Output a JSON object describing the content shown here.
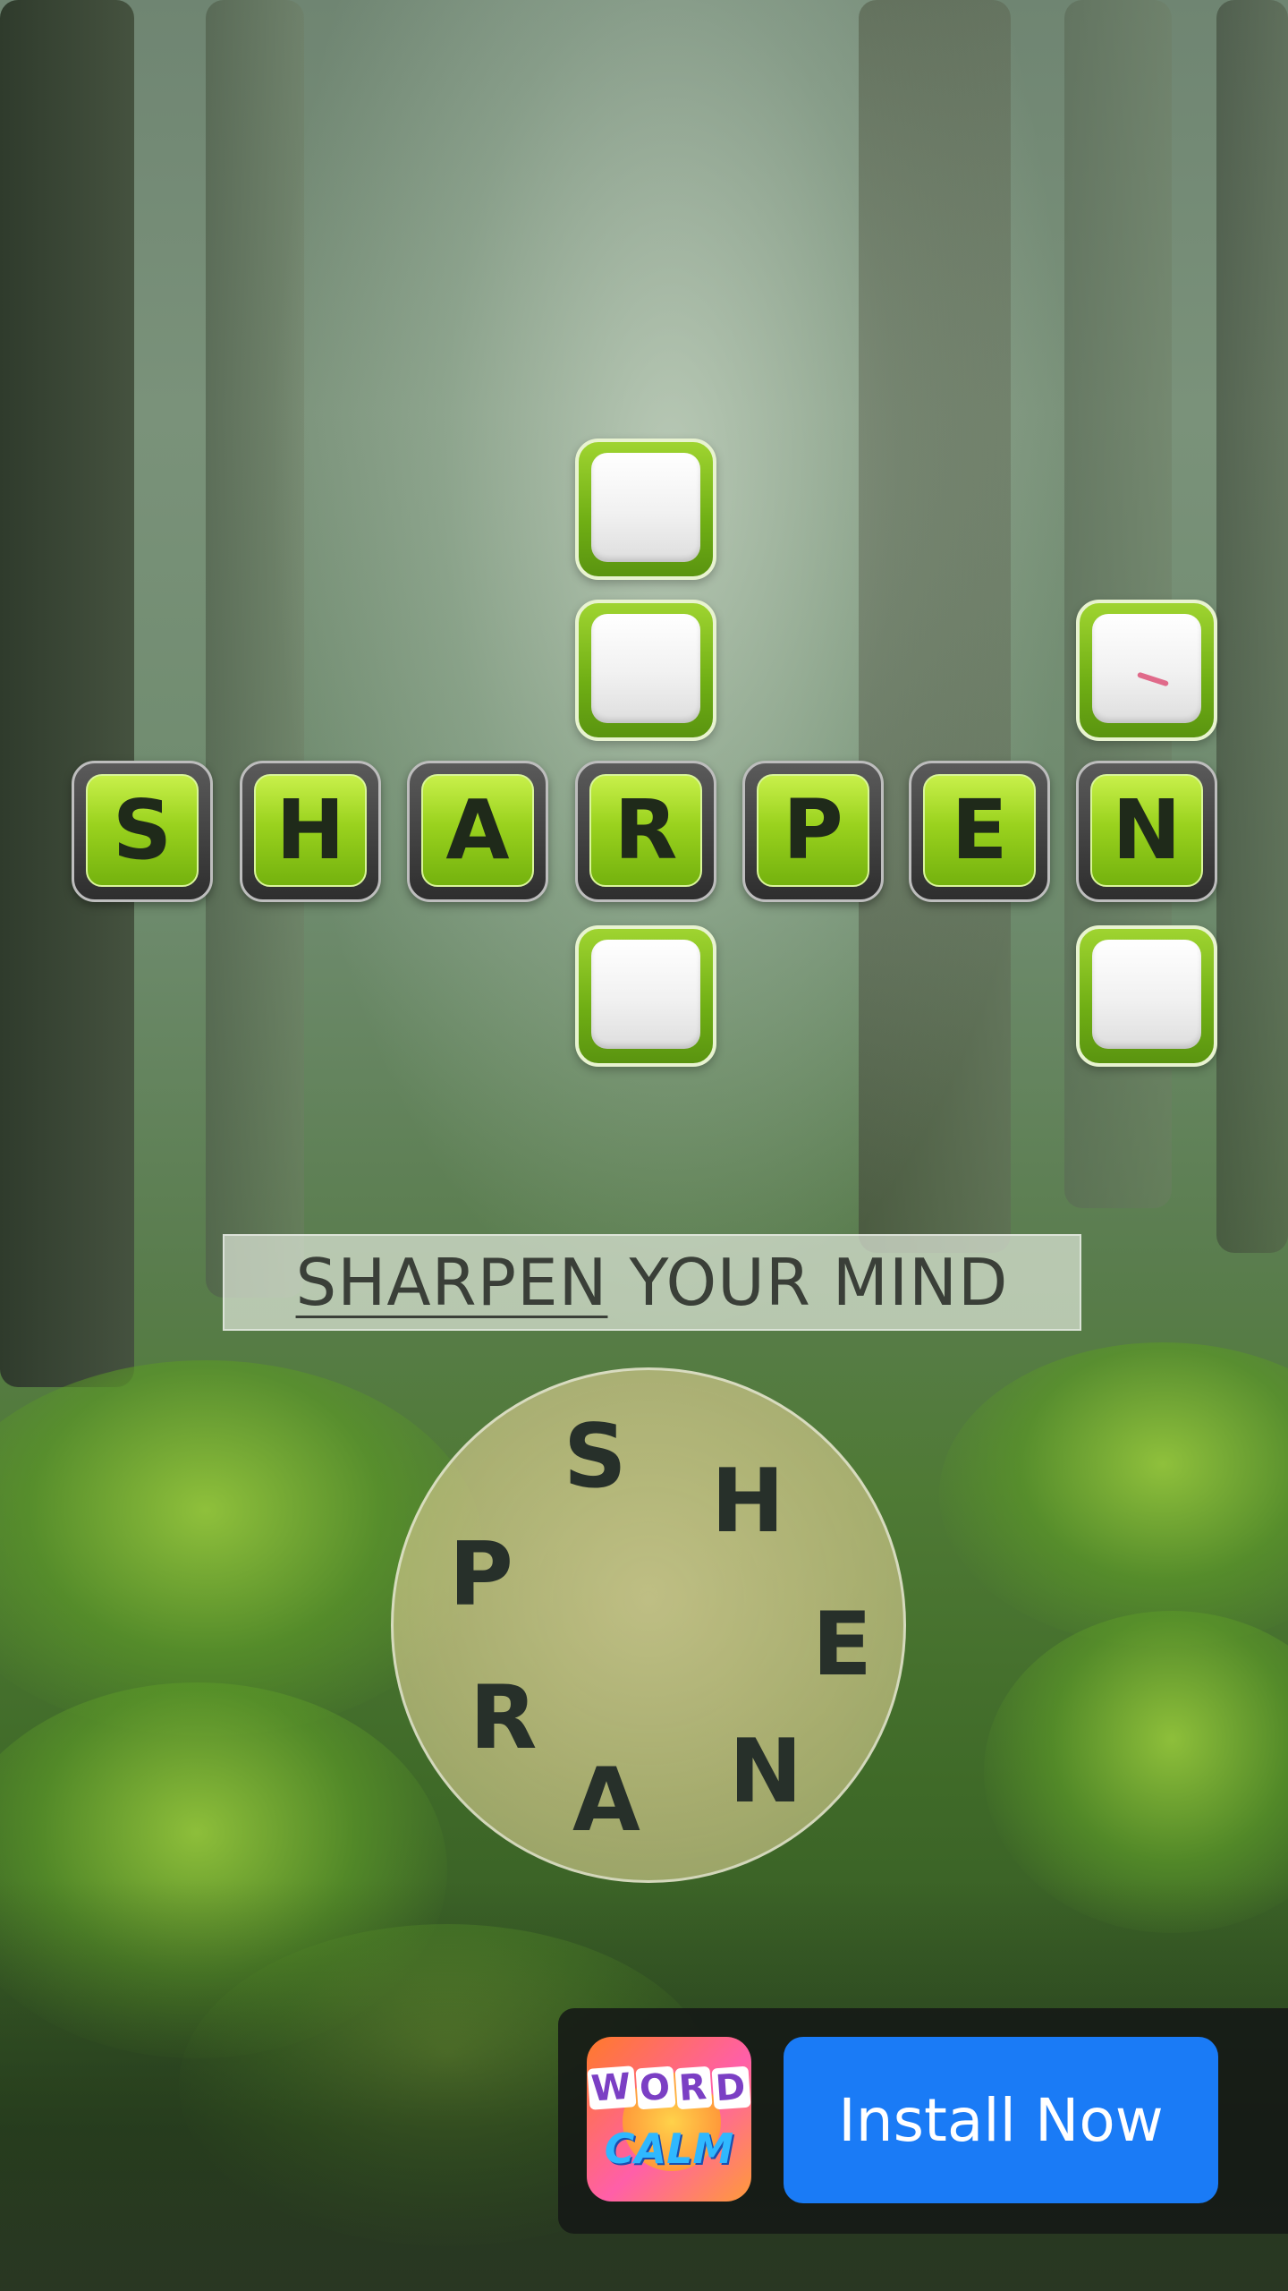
{
  "puzzle": {
    "solved_word": "SHARPEN",
    "solved_letters": [
      "S",
      "H",
      "A",
      "R",
      "P",
      "E",
      "N"
    ],
    "empty_tile_count": 5
  },
  "clue": {
    "highlighted": "SHARPEN",
    "rest": "YOUR MIND"
  },
  "wheel": {
    "letters": [
      "S",
      "H",
      "E",
      "N",
      "A",
      "R",
      "P"
    ]
  },
  "ad": {
    "icon_name": "word-calm-app-icon",
    "icon_line1_letters": [
      "W",
      "O",
      "R",
      "D"
    ],
    "icon_line2": "CALM",
    "button_label": "Install Now",
    "button_color": "#1a7bf6"
  },
  "colors": {
    "tile_green": "#9ad21e",
    "tile_frame": "#2e2e2e"
  }
}
